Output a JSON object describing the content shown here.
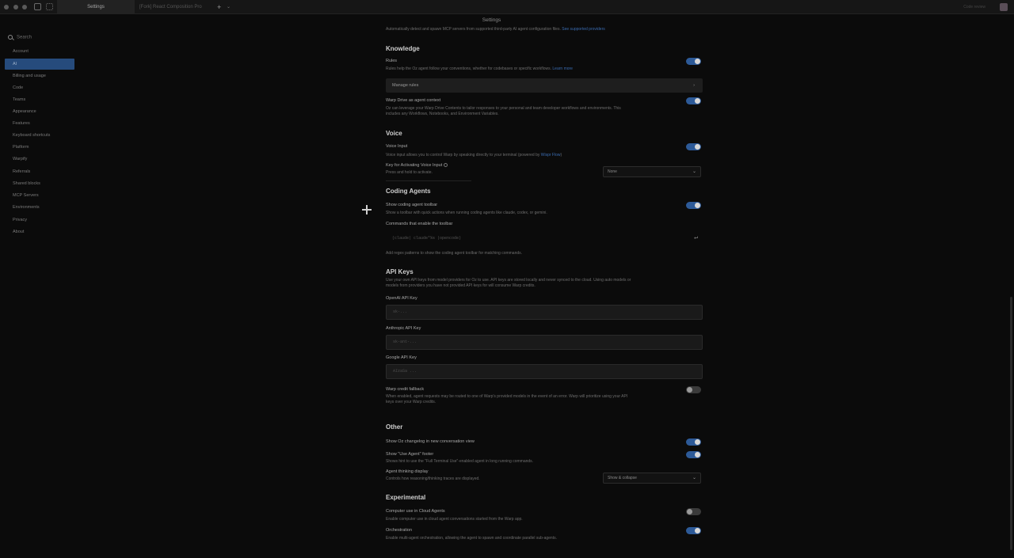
{
  "titlebar": {
    "tabs": [
      {
        "label": "Settings"
      },
      {
        "label": "[Fork] React Composition Pro"
      }
    ],
    "new_tab_label": "+",
    "new_tab_caret": "⌄",
    "right_text": "Code review"
  },
  "sidebar": {
    "search_placeholder": "Search",
    "items": [
      {
        "label": "Account"
      },
      {
        "label": "AI"
      },
      {
        "label": "Billing and usage"
      },
      {
        "label": "Code"
      },
      {
        "label": "Teams"
      },
      {
        "label": "Appearance"
      },
      {
        "label": "Features"
      },
      {
        "label": "Keyboard shortcuts"
      },
      {
        "label": "Platform"
      },
      {
        "label": "Warpify"
      },
      {
        "label": "Referrals"
      },
      {
        "label": "Shared blocks"
      },
      {
        "label": "MCP Servers"
      },
      {
        "label": "Environments"
      },
      {
        "label": "Privacy"
      },
      {
        "label": "About"
      }
    ]
  },
  "page": {
    "title": "Settings",
    "top_desc": "Automatically detect and spawn MCP servers from supported third-party AI agent configuration files.",
    "top_link": "See supported providers"
  },
  "knowledge": {
    "heading": "Knowledge",
    "rules_label": "Rules",
    "rules_desc": "Rules help the Oz agent follow your conventions, whether for codebases or specific workflows.",
    "rules_link": "Learn more",
    "manage_rules": "Manage rules",
    "warp_drive_label": "Warp Drive as agent context",
    "warp_drive_desc1": "Oz can leverage your Warp Drive Contents to tailor responses to your personal and team developer workflows and environments. This",
    "warp_drive_desc2": "includes any Workflows, Notebooks, and Environment Variables."
  },
  "voice": {
    "heading": "Voice",
    "input_label": "Voice Input",
    "input_desc": "Voice input allows you to control Warp by speaking directly to your terminal (powered by",
    "input_link": "Wispr Flow",
    "key_label": "Key for Activating Voice Input",
    "key_desc": "Press and hold to activate.",
    "key_value": "None"
  },
  "coding_agents": {
    "heading": "Coding Agents",
    "toolbar_label": "Show coding agent toolbar",
    "toolbar_desc": "Show a toolbar with quick actions when running coding agents like claude, codex, or gemini.",
    "commands_label": "Commands that enable the toolbar",
    "commands_value": "(claude| claude*%s |opencode)",
    "commands_desc": "Add regex patterns to show the coding agent toolbar for matching commands."
  },
  "api_keys": {
    "heading": "API Keys",
    "desc1": "Use your own API keys from model providers for Oz to use. API keys are stored locally and never synced to the cloud. Using auto models or",
    "desc2": "models from providers you have not provided API keys for will consume Warp credits.",
    "openai_label": "OpenAI API Key",
    "openai_placeholder": "sk-...",
    "anthropic_label": "Anthropic API Key",
    "anthropic_placeholder": "sk-ant-...",
    "google_label": "Google API Key",
    "google_placeholder": "AIzaSa ...",
    "fallback_label": "Warp credit fallback",
    "fallback_desc1": "When enabled, agent requests may be routed to one of Warp's provided models in the event of an error. Warp will prioritize using your API",
    "fallback_desc2": "keys over your Warp credits."
  },
  "other": {
    "heading": "Other",
    "changelog_label": "Show Oz changelog in new conversation view",
    "use_agent_label": "Show \"Use Agent\" footer",
    "use_agent_desc": "Shows hint to use the \"Full Terminal Use\"-enabled agent in long running commands.",
    "thinking_label": "Agent thinking display",
    "thinking_desc": "Controls how reasoning/thinking traces are displayed.",
    "thinking_value": "Show & collapse"
  },
  "experimental": {
    "heading": "Experimental",
    "cloud_label": "Computer use in Cloud Agents",
    "cloud_desc": "Enable computer use in cloud agent conversations started from the Warp app.",
    "orch_label": "Orchestration",
    "orch_desc": "Enable multi-agent orchestration, allowing the agent to spawn and coordinate parallel sub-agents."
  },
  "icons": {
    "chevron": "›",
    "dropdown": "⌄",
    "enter": "↵"
  },
  "toggles": {
    "rules": true,
    "warp_drive": true,
    "voice_input": true,
    "coding_toolbar": true,
    "credit_fallback": false,
    "changelog": true,
    "use_agent_footer": true,
    "cloud_computer_use": false,
    "orchestration": true
  },
  "colors": {
    "accent": "#2d5a98",
    "active_nav": "#264b7c",
    "link": "#3a6bb0"
  }
}
